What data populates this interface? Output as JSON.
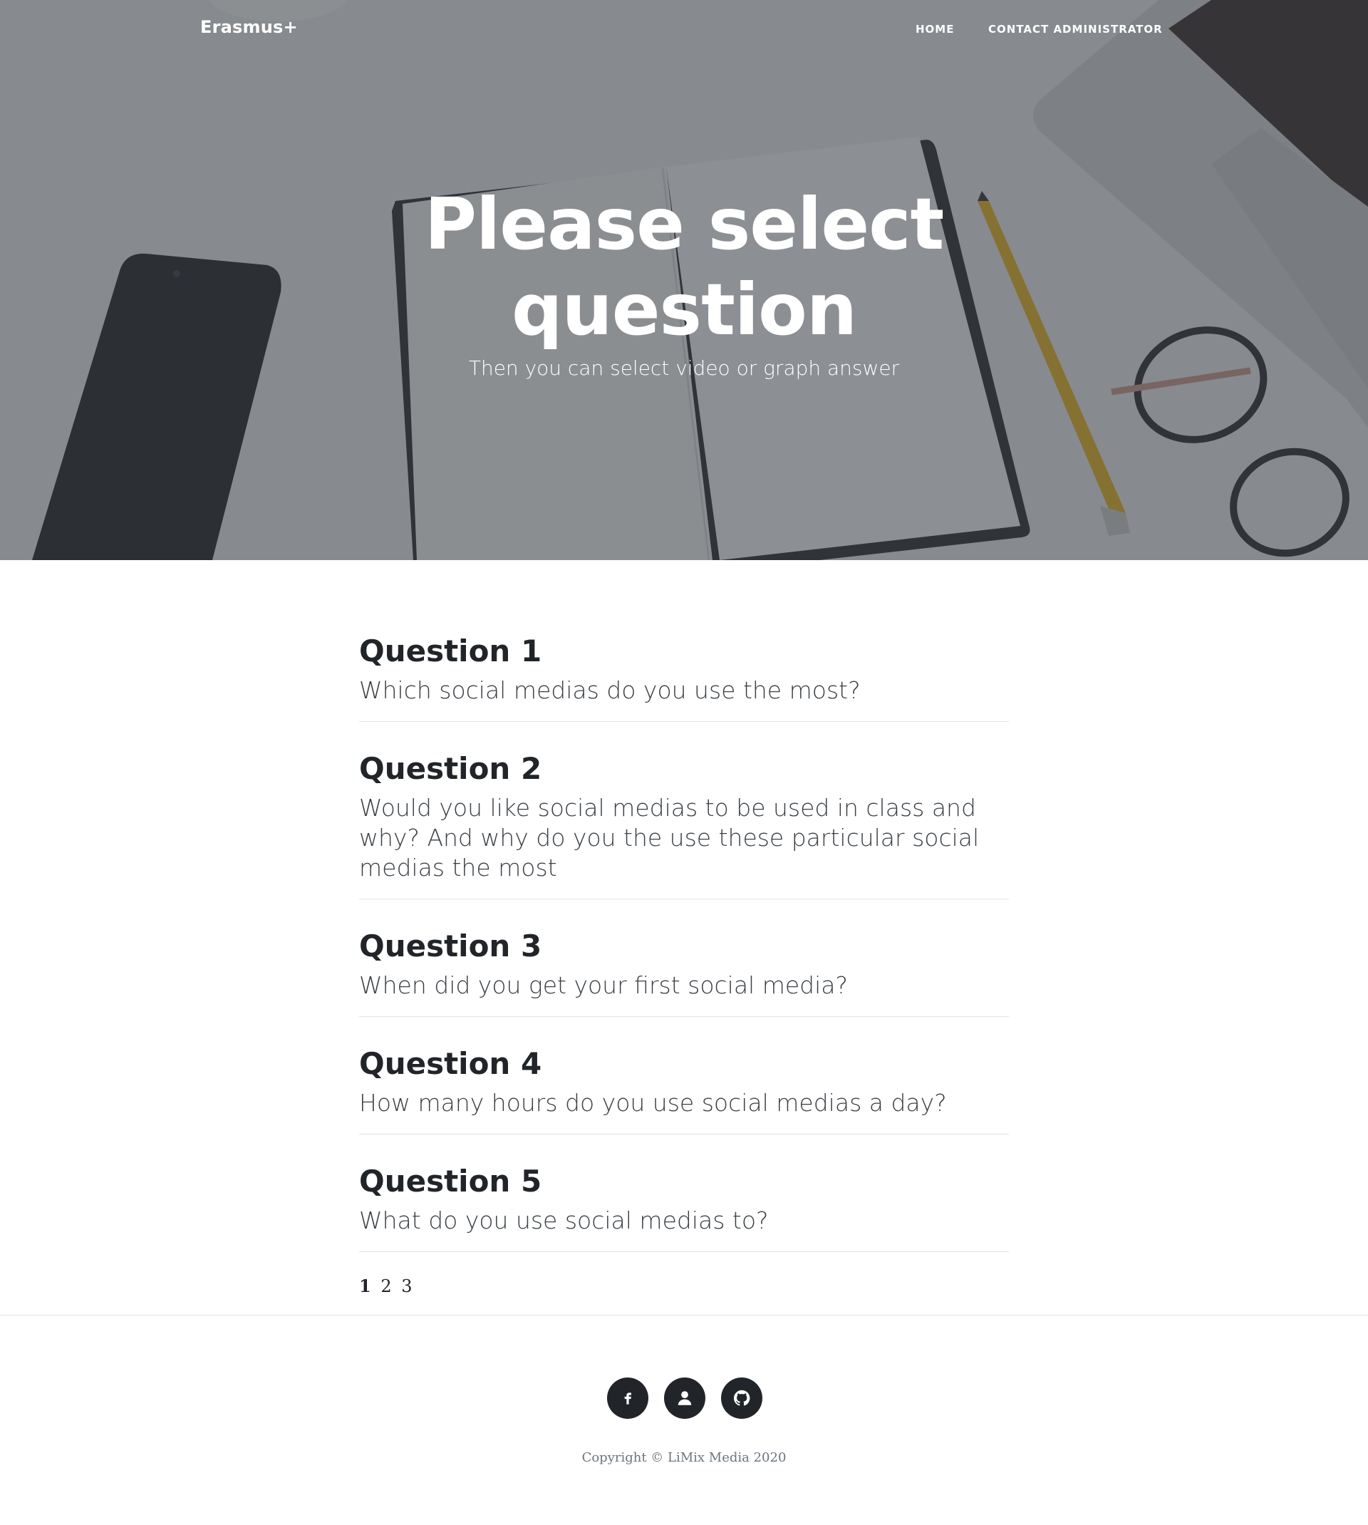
{
  "navbar": {
    "brand": "Erasmus+",
    "links": [
      "HOME",
      "CONTACT ADMINISTRATOR"
    ]
  },
  "hero": {
    "title": "Please select question",
    "subtitle": "Then you can select video or graph answer",
    "background_image": "desk-with-notebook-phone-laptop-pencil-glasses"
  },
  "questions": [
    {
      "title": "Question 1",
      "text": "Which social medias do you use the most?"
    },
    {
      "title": "Question 2",
      "text": "Would you like social medias to be used in class and why? And why do you the use these particular social medias the most"
    },
    {
      "title": "Question 3",
      "text": "When did you get your first social media?"
    },
    {
      "title": "Question 4",
      "text": "How many hours do you use social medias a day?"
    },
    {
      "title": "Question 5",
      "text": "What do you use social medias to?"
    }
  ],
  "pagination": {
    "pages": [
      "1",
      "2",
      "3"
    ],
    "current": "1"
  },
  "footer": {
    "socials": [
      "facebook-icon",
      "user-icon",
      "github-icon"
    ],
    "copyright": "Copyright © LiMix Media 2020"
  },
  "colors": {
    "overlay": "#343a40",
    "text_dark": "#212529",
    "footer_icon_bg": "#212529"
  }
}
